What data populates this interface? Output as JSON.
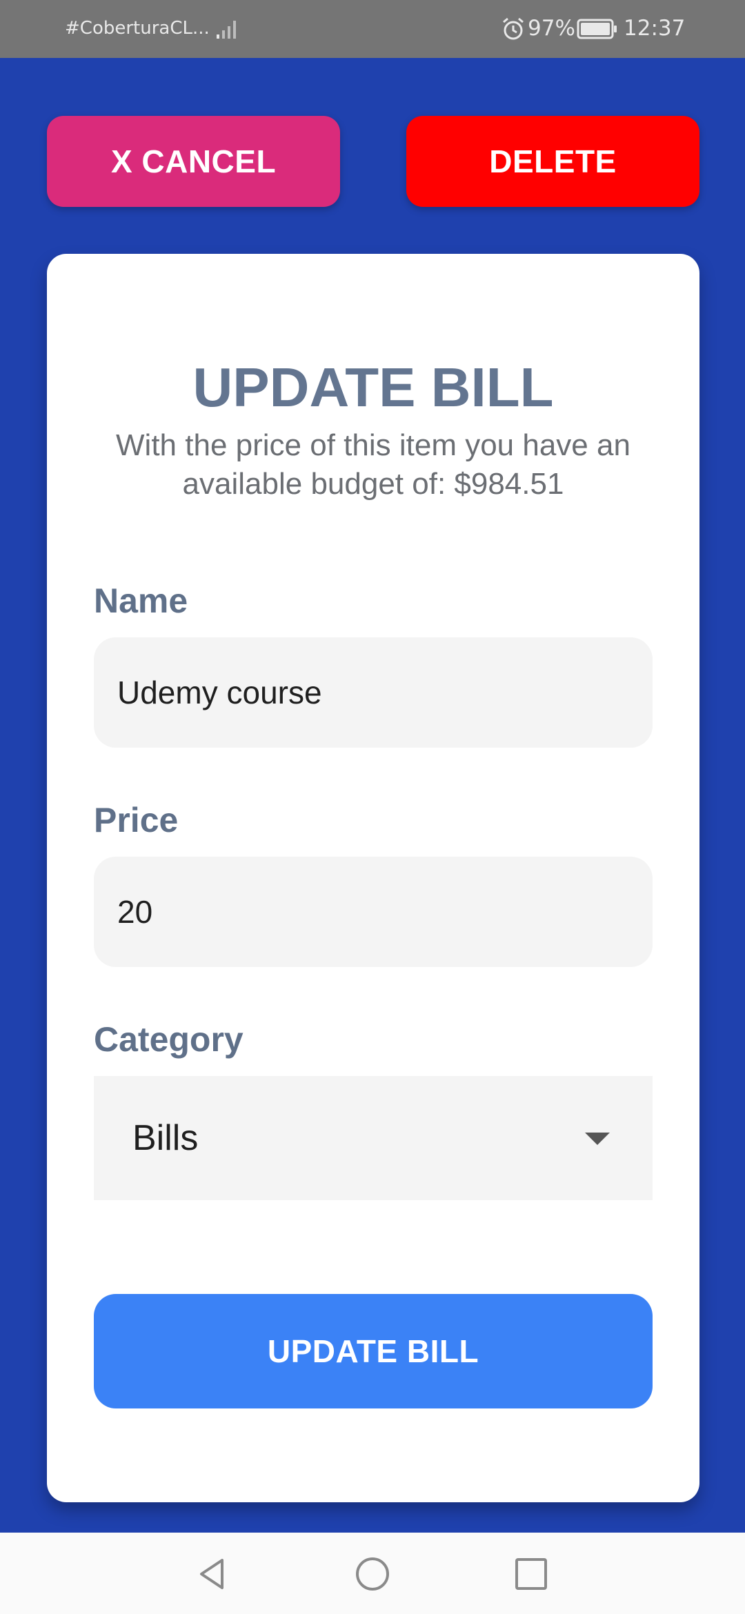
{
  "status_bar": {
    "carrier": "#CoberturaCL...",
    "battery_percent": "97%",
    "time": "12:37",
    "icons": [
      "signal-icon",
      "alarm-icon",
      "battery-icon"
    ]
  },
  "actions": {
    "cancel_label": "X CANCEL",
    "delete_label": "DELETE"
  },
  "form": {
    "title": "UPDATE BILL",
    "subtitle": "With the price of this item you have an available budget of: $984.51",
    "name": {
      "label": "Name",
      "value": "Udemy course"
    },
    "price": {
      "label": "Price",
      "value": "20"
    },
    "category": {
      "label": "Category",
      "value": "Bills"
    },
    "submit_label": "UPDATE BILL"
  },
  "nav": {
    "icons": [
      "back-icon",
      "home-icon",
      "recents-icon"
    ]
  },
  "colors": {
    "background": "#1f41ae",
    "cancel": "#da2b7b",
    "delete": "#ff0000",
    "submit": "#3b82f6",
    "label": "#5f7089"
  }
}
